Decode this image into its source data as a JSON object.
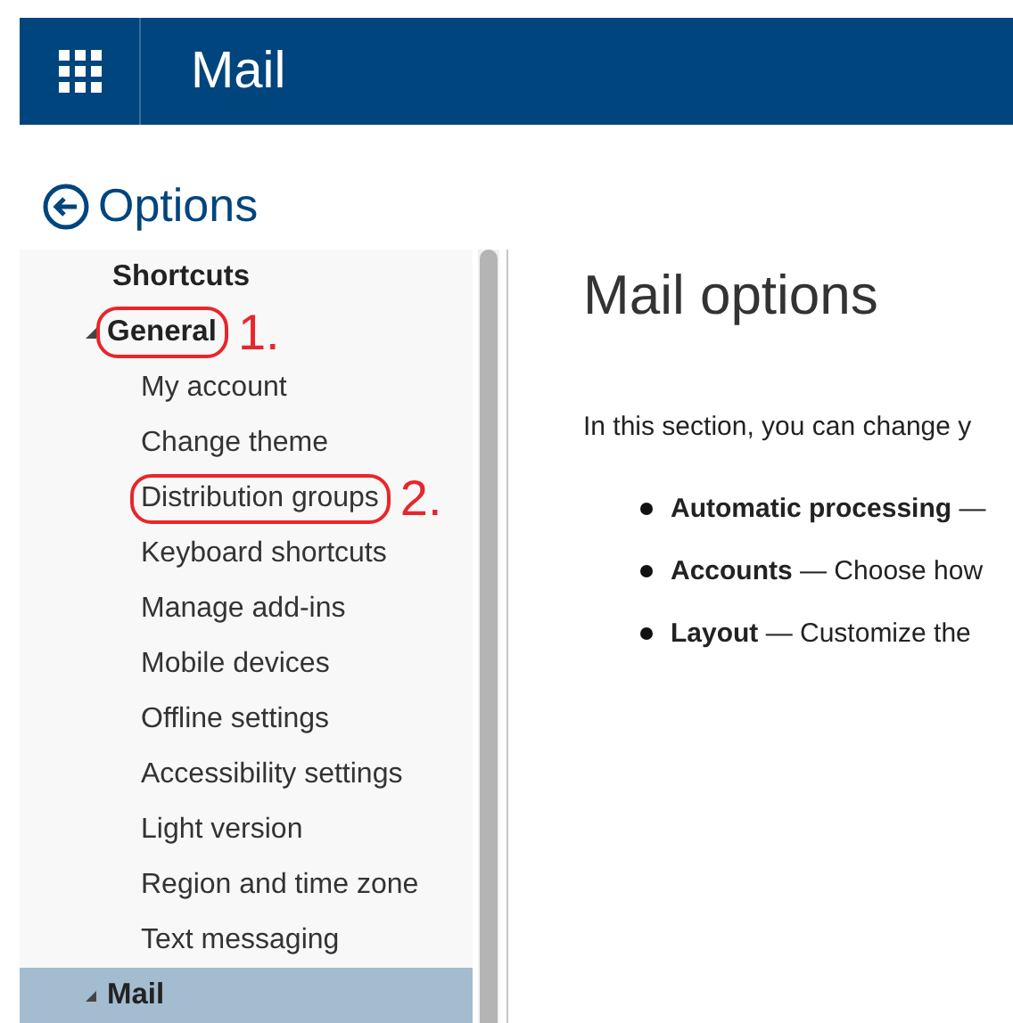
{
  "app_bar": {
    "title": "Mail"
  },
  "back": {
    "label": "Options"
  },
  "nav": [
    {
      "label": "Shortcuts",
      "kind": "link",
      "selected": false
    },
    {
      "label": "General",
      "kind": "group",
      "expanded": true,
      "selected": false,
      "annotation": "1.",
      "children": [
        {
          "label": "My account",
          "selected": false
        },
        {
          "label": "Change theme",
          "selected": false
        },
        {
          "label": "Distribution groups",
          "selected": false,
          "annotation": "2."
        },
        {
          "label": "Keyboard shortcuts",
          "selected": false
        },
        {
          "label": "Manage add-ins",
          "selected": false
        },
        {
          "label": "Mobile devices",
          "selected": false
        },
        {
          "label": "Offline settings",
          "selected": false
        },
        {
          "label": "Accessibility settings",
          "selected": false
        },
        {
          "label": "Light version",
          "selected": false
        },
        {
          "label": "Region and time zone",
          "selected": false
        },
        {
          "label": "Text messaging",
          "selected": false
        }
      ]
    },
    {
      "label": "Mail",
      "kind": "group",
      "expanded": true,
      "selected": true
    }
  ],
  "content": {
    "title": "Mail options",
    "intro": "In this section, you can change y",
    "bullets": [
      "**Automatic processing** —",
      "**Accounts** — Choose how",
      "**Layout** — Customize the"
    ]
  }
}
